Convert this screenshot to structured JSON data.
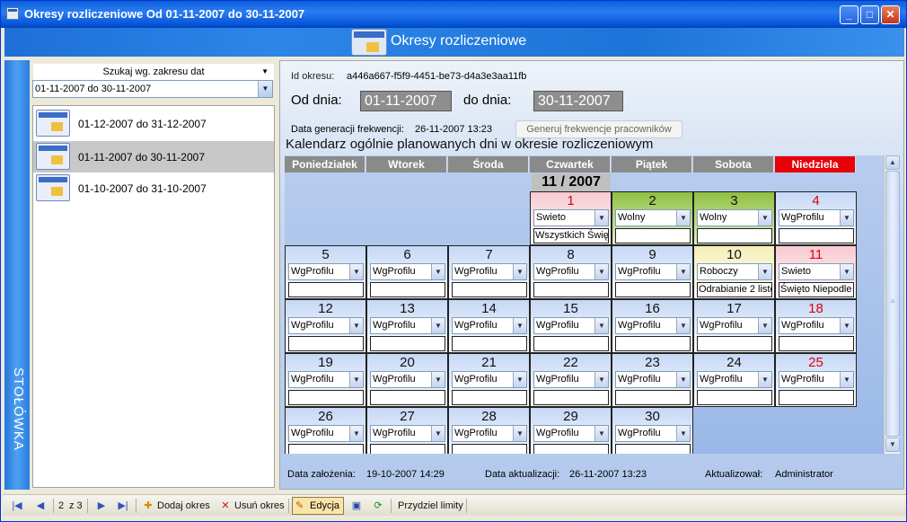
{
  "window": {
    "title": "Okresy rozliczeniowe  Od 01-11-2007 do 30-11-2007",
    "buttons": {
      "minimize": "_",
      "maximize": "□",
      "close": "✕"
    }
  },
  "header": {
    "title": "Okresy rozliczeniowe"
  },
  "sidebar": {
    "vertical_label": "STOŁÓWKA"
  },
  "search": {
    "label": "Szukaj wg. zakresu dat",
    "value": "01-11-2007 do 30-11-2007"
  },
  "periods": [
    {
      "label": "01-12-2007 do 31-12-2007"
    },
    {
      "label": "01-11-2007 do 30-11-2007"
    },
    {
      "label": "01-10-2007 do 31-10-2007"
    }
  ],
  "details": {
    "id_label": "Id okresu:",
    "id_value": "a446a667-f5f9-4451-be73-d4a3e3aa11fb",
    "from_label": "Od dnia:",
    "from_value": "01-11-2007",
    "to_label": "do dnia:",
    "to_value": "30-11-2007",
    "gen_label": "Data generacji frekwencji:",
    "gen_value": "26-11-2007 13:23",
    "gen_button": "Generuj frekwencje pracowników"
  },
  "calendar": {
    "title": "Kalendarz ogólnie planowanych dni w okresie rozliczeniowym",
    "month": "11 / 2007",
    "weekdays": [
      "Poniedziałek",
      "Wtorek",
      "Środa",
      "Czwartek",
      "Piątek",
      "Sobota",
      "Niedziela"
    ],
    "days": [
      {
        "day": "1",
        "type": "Swieto",
        "note": "Wszystkich Święt"
      },
      {
        "day": "2",
        "type": "Wolny",
        "note": ""
      },
      {
        "day": "3",
        "type": "Wolny",
        "note": ""
      },
      {
        "day": "4",
        "type": "WgProfilu",
        "note": ""
      },
      {
        "day": "5",
        "type": "WgProfilu",
        "note": ""
      },
      {
        "day": "6",
        "type": "WgProfilu",
        "note": ""
      },
      {
        "day": "7",
        "type": "WgProfilu",
        "note": ""
      },
      {
        "day": "8",
        "type": "WgProfilu",
        "note": ""
      },
      {
        "day": "9",
        "type": "WgProfilu",
        "note": ""
      },
      {
        "day": "10",
        "type": "Roboczy",
        "note": "Odrabianie 2 listo"
      },
      {
        "day": "11",
        "type": "Swieto",
        "note": "Święto Niepodle"
      },
      {
        "day": "12",
        "type": "WgProfilu",
        "note": ""
      },
      {
        "day": "13",
        "type": "WgProfilu",
        "note": ""
      },
      {
        "day": "14",
        "type": "WgProfilu",
        "note": ""
      },
      {
        "day": "15",
        "type": "WgProfilu",
        "note": ""
      },
      {
        "day": "16",
        "type": "WgProfilu",
        "note": ""
      },
      {
        "day": "17",
        "type": "WgProfilu",
        "note": ""
      },
      {
        "day": "18",
        "type": "WgProfilu",
        "note": ""
      },
      {
        "day": "19",
        "type": "WgProfilu",
        "note": ""
      },
      {
        "day": "20",
        "type": "WgProfilu",
        "note": ""
      },
      {
        "day": "21",
        "type": "WgProfilu",
        "note": ""
      },
      {
        "day": "22",
        "type": "WgProfilu",
        "note": ""
      },
      {
        "day": "23",
        "type": "WgProfilu",
        "note": ""
      },
      {
        "day": "24",
        "type": "WgProfilu",
        "note": ""
      },
      {
        "day": "25",
        "type": "WgProfilu",
        "note": ""
      },
      {
        "day": "26",
        "type": "WgProfilu",
        "note": ""
      },
      {
        "day": "27",
        "type": "WgProfilu",
        "note": ""
      },
      {
        "day": "28",
        "type": "WgProfilu",
        "note": ""
      },
      {
        "day": "29",
        "type": "WgProfilu",
        "note": ""
      },
      {
        "day": "30",
        "type": "WgProfilu",
        "note": ""
      }
    ]
  },
  "footer": {
    "created_label": "Data założenia:",
    "created_value": "19-10-2007 14:29",
    "updated_label": "Data aktualizacji:",
    "updated_value": "26-11-2007 13:23",
    "updated_by_label": "Aktualizował:",
    "updated_by_value": "Administrator"
  },
  "toolbar": {
    "position": "2",
    "of_label": "z 3",
    "add_label": "Dodaj okres",
    "delete_label": "Usuń okres",
    "edit_label": "Edycja",
    "limits_label": "Przydziel limity"
  },
  "colors": {
    "holiday": "#e00010",
    "weekend_header": "#e8000a",
    "free_day": "#8fc03f",
    "workday": "#f6eeb8"
  }
}
